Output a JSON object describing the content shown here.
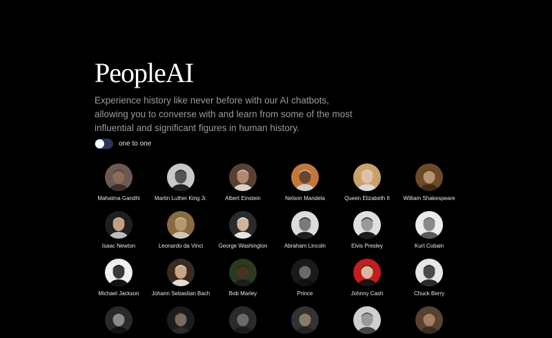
{
  "brand": {
    "title": "PeopleAI"
  },
  "hero": {
    "tagline": "Experience history like never before with our AI chatbots, allowing you to converse with and learn from some of the most influential and significant figures in human history."
  },
  "mode_toggle": {
    "label": "one to one",
    "on": false
  },
  "people": [
    {
      "name": "Mahatma Gandhi",
      "bg": "#6b5a52",
      "face": "#8e6a55",
      "hair": "#3a2e29"
    },
    {
      "name": "Martin Luther King Jr.",
      "bg": "#c9c9c9",
      "face": "#555",
      "hair": "#222"
    },
    {
      "name": "Albert Einstein",
      "bg": "#5a4032",
      "face": "#b08a70",
      "hair": "#d8d2cc"
    },
    {
      "name": "Nelson Mandela",
      "bg": "#c4773a",
      "face": "#6a4530",
      "hair": "#cfcfcf"
    },
    {
      "name": "Queen Elizabeth II",
      "bg": "#c9a26a",
      "face": "#e2c0a6",
      "hair": "#d9d9d9"
    },
    {
      "name": "William Shakespeare",
      "bg": "#6a4a28",
      "face": "#b79470",
      "hair": "#3e2a17"
    },
    {
      "name": "Isaac Newton",
      "bg": "#1f1f1f",
      "face": "#c2a07e",
      "hair": "#bdbdbd"
    },
    {
      "name": "Leonardo da Vinci",
      "bg": "#8a6a40",
      "face": "#b89870",
      "hair": "#cfc7b8"
    },
    {
      "name": "George Washington",
      "bg": "#2a2a2a",
      "face": "#d2b29a",
      "hair": "#e5e5e5"
    },
    {
      "name": "Abraham Lincoln",
      "bg": "#dcdcdc",
      "face": "#7a7a7a",
      "hair": "#1e1e1e"
    },
    {
      "name": "Elvis Presley",
      "bg": "#e0e0e0",
      "face": "#9a9a9a",
      "hair": "#1c1c1c"
    },
    {
      "name": "Kurt Cobain",
      "bg": "#ececec",
      "face": "#8a8a8a",
      "hair": "#5a5a5a"
    },
    {
      "name": "Michael Jackson",
      "bg": "#f0f0f0",
      "face": "#3a3a3a",
      "hair": "#111"
    },
    {
      "name": "Johann Sebastian Bach",
      "bg": "#3a2a20",
      "face": "#c9a585",
      "hair": "#e2dcd4"
    },
    {
      "name": "Bob Marley",
      "bg": "#2a3a1e",
      "face": "#4a3224",
      "hair": "#1d1d1d"
    },
    {
      "name": "Prince",
      "bg": "#1a1a1a",
      "face": "#6a6a6a",
      "hair": "#111"
    },
    {
      "name": "Johnny Cash",
      "bg": "#c21e1e",
      "face": "#d8b99e",
      "hair": "#141414"
    },
    {
      "name": "Chuck Berry",
      "bg": "#e6e6e6",
      "face": "#4a4a4a",
      "hair": "#2a2a2a"
    },
    {
      "name": "",
      "bg": "#2a2a2a",
      "face": "#8a8a8a",
      "hair": "#111"
    },
    {
      "name": "",
      "bg": "#1c1c1c",
      "face": "#7a6a5a",
      "hair": "#2a2a2a"
    },
    {
      "name": "",
      "bg": "#2a2a2a",
      "face": "#6a6a6a",
      "hair": "#1a1a1a"
    },
    {
      "name": "",
      "bg": "#333",
      "face": "#8a7a6a",
      "hair": "#222"
    },
    {
      "name": "",
      "bg": "#cfcfcf",
      "face": "#9a9a9a",
      "hair": "#444"
    },
    {
      "name": "",
      "bg": "#5a4030",
      "face": "#a08060",
      "hair": "#3a2a1a"
    }
  ]
}
